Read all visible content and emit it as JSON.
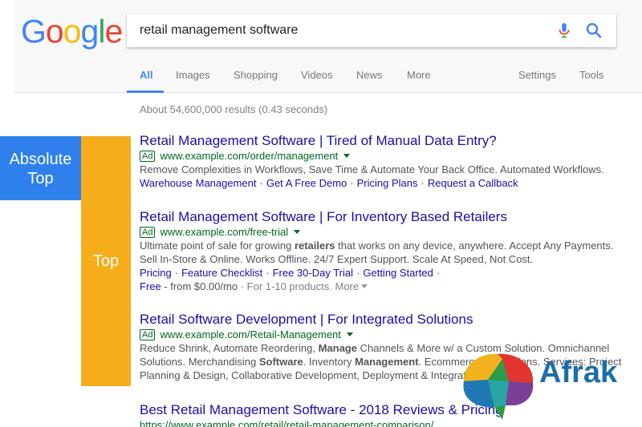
{
  "logo": {
    "letters": [
      "G",
      "o",
      "o",
      "g",
      "l",
      "e"
    ],
    "colors": [
      "#4285f4",
      "#ea4335",
      "#fbbc05",
      "#4285f4",
      "#34a853",
      "#ea4335"
    ]
  },
  "search": {
    "query": "retail management software"
  },
  "tabs": {
    "all": "All",
    "images": "Images",
    "shopping": "Shopping",
    "videos": "Videos",
    "news": "News",
    "more": "More",
    "settings": "Settings",
    "tools": "Tools"
  },
  "stats": "About 54,600,000 results (0.43 seconds)",
  "labels": {
    "absolute_top_line1": "Absolute",
    "absolute_top_line2": "Top",
    "top": "Top"
  },
  "results": [
    {
      "title": "Retail Management Software | Tired of Manual Data Entry?",
      "ad": "Ad",
      "url": "www.example.com/order/management",
      "desc1": "Remove Complexities in Workflows, Save Time & Automate Your Back Office. Automated Workflows.",
      "sitelinks": [
        "Warehouse Management",
        "Get A Free Demo",
        "Pricing Plans",
        "Request a Callback"
      ]
    },
    {
      "title": "Retail Management Software | For Inventory Based Retailers",
      "ad": "Ad",
      "url": "www.example.com/free-trial",
      "desc1_a": "Ultimate point of sale for growing ",
      "desc1_b": "retailers",
      "desc1_c": " that works on any device, anywhere. Accept Any Payments.",
      "desc2": "Sell In-Store & Online. Works Offline. 24/7 Expert Support. Scale At Speed, Not Cost.",
      "sitelinks": [
        "Pricing",
        "Feature Checklist",
        "Free 30-Day Trial",
        "Getting Started"
      ],
      "ext_free": "Free",
      "ext_price": " - from $0.00/mo",
      "ext_products": " · For 1-10 products.",
      "ext_more": " More"
    },
    {
      "title": "Retail Software Development | For Integrated Solutions",
      "ad": "Ad",
      "url": "www.example.com/Retail-Management",
      "desc1_a": "Reduce Shrink, Automate Reordering, ",
      "desc1_b": "Manage",
      "desc1_c": " Channels & More w/ a Custom Solution. Omnichannel",
      "desc2_a": "Solutions. Merchandising ",
      "desc2_b": "Software",
      "desc2_c": ". Inventory ",
      "desc2_d": "Management",
      "desc2_e": ". Ecommerce Integrations. Services: Project",
      "desc3": "Planning & Design, Collaborative Development, Deployment & Integration."
    },
    {
      "title": "Best Retail Management Software - 2018 Reviews & Pricing",
      "url": "https://www.example.com/retail/retail-management-comparison/"
    }
  ],
  "watermark": {
    "text": "Afrak"
  }
}
